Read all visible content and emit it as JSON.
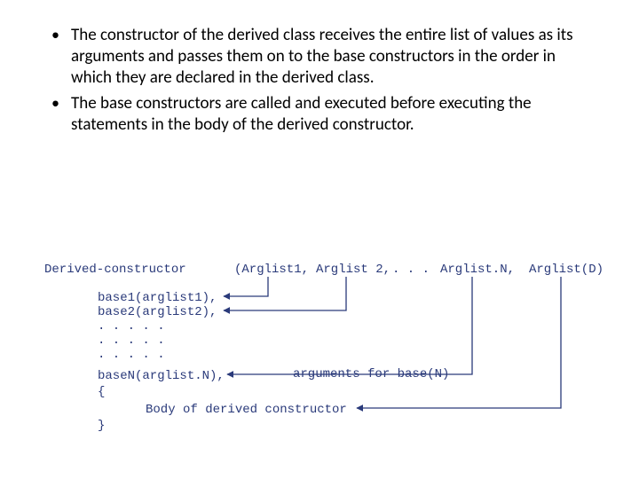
{
  "bullets": {
    "item1": "The constructor of the derived class receives the entire list of values as its arguments and passes them on to the base constructors in the order in which they are declared in the derived class.",
    "item2": "The base constructors are called and executed before executing the statements in the body of the derived constructor."
  },
  "diagram": {
    "headerLeft": "Derived-constructor",
    "argA": "(Arglist1,",
    "argB": "Arglist 2,",
    "argC": ". . .",
    "argN": "Arglist.N,",
    "argD": "Arglist(D)",
    "base1": "base1(arglist1),",
    "base2": "base2(arglist2),",
    "dots1": ". . . . .",
    "dots2": ". . . . .",
    "dots3": ". . . . .",
    "baseN": "baseN(arglist.N),",
    "openBrace": "{",
    "body": "Body of derived constructor",
    "closeBrace": "}",
    "annotBaseN": "arguments for base(N)"
  }
}
